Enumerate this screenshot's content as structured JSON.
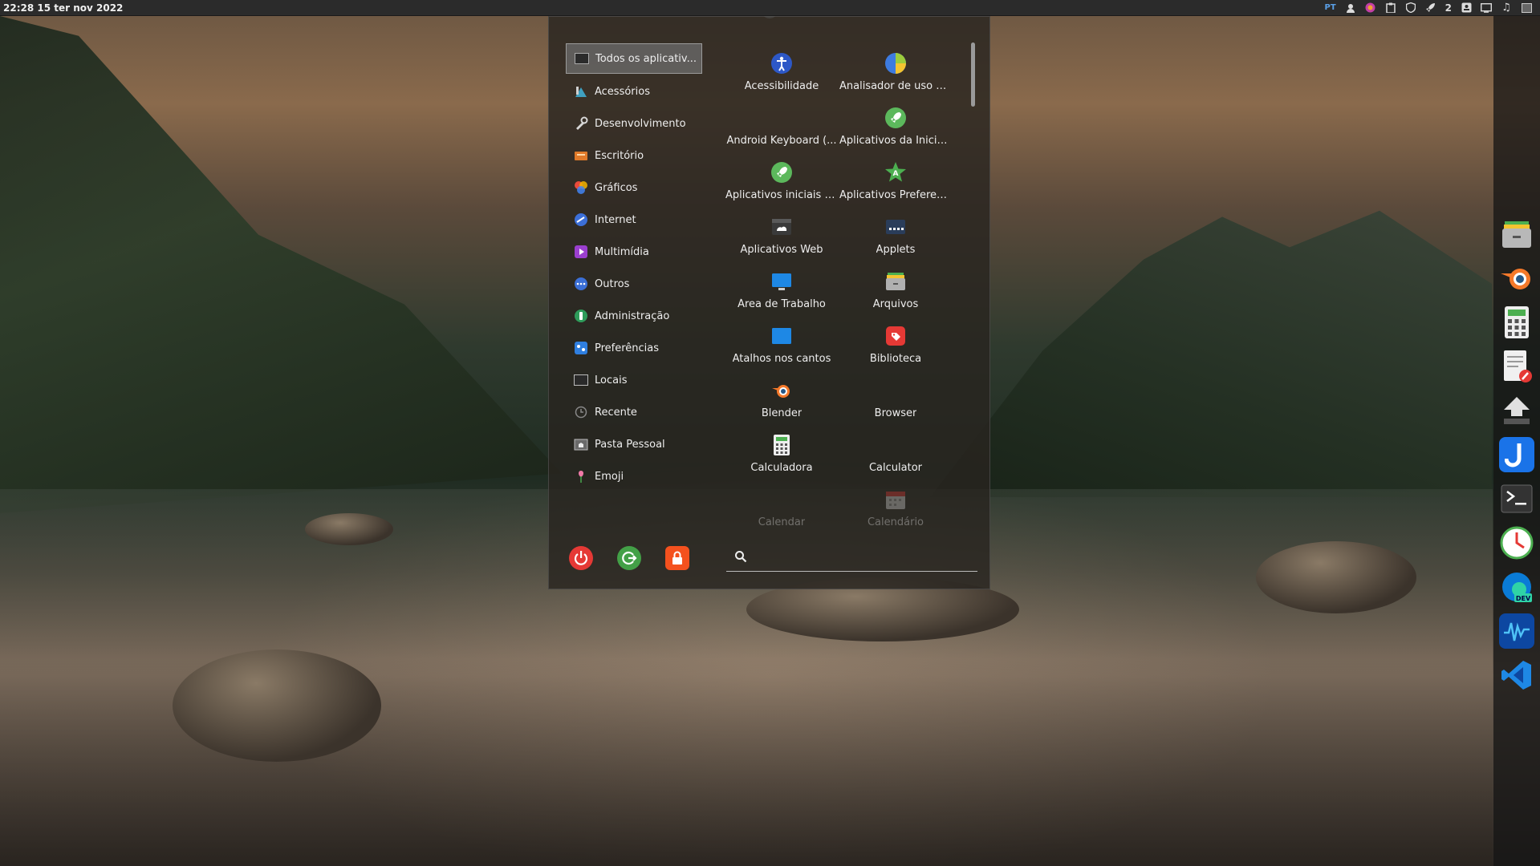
{
  "panel": {
    "clock": "22:28 15 ter nov 2022",
    "language": "PT",
    "workspace_count": "2",
    "tray_icons": [
      "user-icon",
      "color-picker-icon",
      "clipboard-icon",
      "shield-icon",
      "rocket-icon",
      "contact-icon",
      "screen-icon",
      "music-icon",
      "desktop-icon"
    ]
  },
  "menu": {
    "categories": [
      {
        "label": "Todos os aplicativ...",
        "icon": "all-apps-icon"
      },
      {
        "label": "Acessórios",
        "icon": "accessories-icon"
      },
      {
        "label": "Desenvolvimento",
        "icon": "development-icon"
      },
      {
        "label": "Escritório",
        "icon": "office-icon"
      },
      {
        "label": "Gráficos",
        "icon": "graphics-icon"
      },
      {
        "label": "Internet",
        "icon": "internet-icon"
      },
      {
        "label": "Multimídia",
        "icon": "multimedia-icon"
      },
      {
        "label": "Outros",
        "icon": "others-icon"
      },
      {
        "label": "Administração",
        "icon": "administration-icon"
      },
      {
        "label": "Preferências",
        "icon": "preferences-icon"
      },
      {
        "label": "Locais",
        "icon": "places-icon"
      },
      {
        "label": "Recente",
        "icon": "recent-icon"
      },
      {
        "label": "Pasta Pessoal",
        "icon": "home-folder-icon"
      },
      {
        "label": "Emoji",
        "icon": "emoji-icon"
      }
    ],
    "apps": [
      {
        "label": "Acessibilidade",
        "icon": "accessibility-icon"
      },
      {
        "label": "Analisador de uso d...",
        "icon": "disk-usage-icon"
      },
      {
        "label": "Android Keyboard (...",
        "icon": "keyboard-icon"
      },
      {
        "label": "Aplicativos da Inicial...",
        "icon": "startup-apps-icon"
      },
      {
        "label": "Aplicativos iniciais d...",
        "icon": "startup-apps-icon"
      },
      {
        "label": "Aplicativos Preferen...",
        "icon": "preferred-apps-icon"
      },
      {
        "label": "Aplicativos Web",
        "icon": "web-apps-icon"
      },
      {
        "label": "Applets",
        "icon": "applets-icon"
      },
      {
        "label": "Área de Trabalho",
        "icon": "desktop-icon"
      },
      {
        "label": "Arquivos",
        "icon": "files-icon"
      },
      {
        "label": "Atalhos nos cantos",
        "icon": "hot-corners-icon"
      },
      {
        "label": "Biblioteca",
        "icon": "library-icon"
      },
      {
        "label": "Blender",
        "icon": "blender-icon"
      },
      {
        "label": "Browser",
        "icon": "browser-icon"
      },
      {
        "label": "Calculadora",
        "icon": "calculator-icon"
      },
      {
        "label": "Calculator",
        "icon": "calculator-alt-icon"
      },
      {
        "label": "Calendar",
        "icon": "calendar-icon"
      },
      {
        "label": "Calendário",
        "icon": "calendar-icon"
      }
    ],
    "search": {
      "placeholder": "",
      "value": ""
    },
    "system_buttons": [
      "power-icon",
      "logout-icon",
      "lock-icon"
    ]
  },
  "dock": [
    "files-icon",
    "blender-icon",
    "calculator-icon",
    "text-editor-icon",
    "upload-icon",
    "joplin-icon",
    "terminal-icon",
    "clock-icon",
    "edge-dev-icon",
    "waveform-icon",
    "vscode-icon"
  ]
}
